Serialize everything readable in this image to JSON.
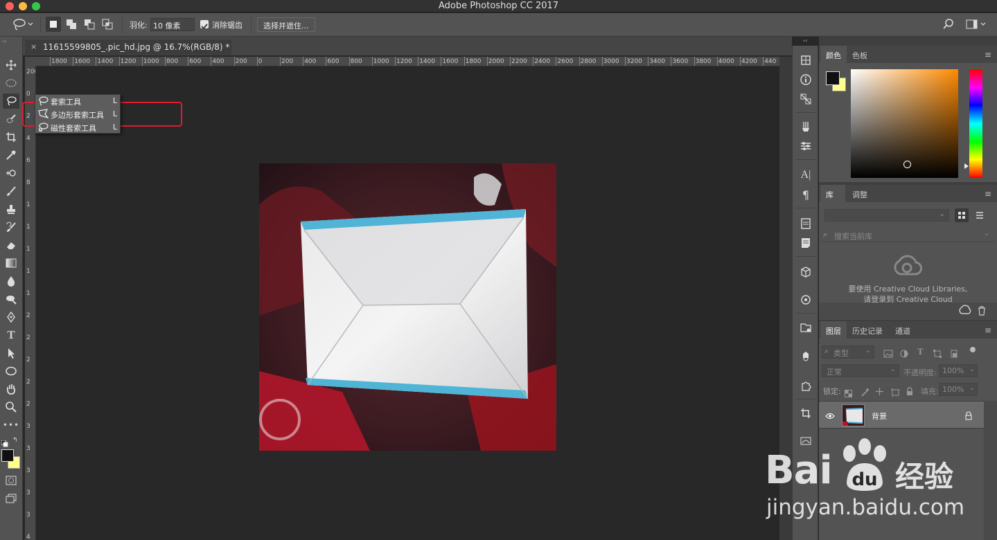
{
  "window": {
    "title": "Adobe Photoshop CC 2017"
  },
  "options_bar": {
    "feather_label": "羽化:",
    "feather_value": "10 像素",
    "antialias_label": "消除锯齿",
    "select_mask_button": "选择并遮住..."
  },
  "document": {
    "tab_title": "11615599805_.pic_hd.jpg @ 16.7%(RGB/8) *",
    "close_symbol": "×"
  },
  "ruler": {
    "h_labels": [
      "1800",
      "1600",
      "1400",
      "1200",
      "1000",
      "800",
      "600",
      "400",
      "200",
      "0",
      "200",
      "400",
      "600",
      "800",
      "1000",
      "1200",
      "1400",
      "1600",
      "1800",
      "2000",
      "2200",
      "2400",
      "2600",
      "2800",
      "3000",
      "3200",
      "3400",
      "3600",
      "3800",
      "4000",
      "4200",
      "440"
    ],
    "v_labels": [
      "200",
      "0",
      "2",
      "4",
      "6",
      "8",
      "1",
      "1",
      "1",
      "1",
      "1",
      "2",
      "2",
      "2",
      "2",
      "2",
      "3",
      "3",
      "3",
      "3",
      "3",
      "4"
    ]
  },
  "lasso_flyout": {
    "items": [
      {
        "label": "套索工具",
        "key": "L"
      },
      {
        "label": "多边形套索工具",
        "key": "L"
      },
      {
        "label": "磁性套索工具",
        "key": "L"
      }
    ]
  },
  "color_panel": {
    "tabs": [
      "颜色",
      "色板"
    ],
    "foreground": "#111111",
    "background": "#fffe8c"
  },
  "library_panel": {
    "tabs": [
      "库",
      "调整"
    ],
    "search_placeholder": "搜索当前库",
    "message_line1": "要使用 Creative Cloud Libraries,",
    "message_line2": "请登录到 Creative Cloud"
  },
  "layers_panel": {
    "tabs": [
      "图层",
      "历史记录",
      "通道"
    ],
    "filter_label": "类型",
    "blend_mode": "正常",
    "opacity_label": "不透明度:",
    "opacity_value": "100%",
    "lock_label": "锁定:",
    "fill_label": "填充:",
    "fill_value": "100%",
    "layers": [
      {
        "name": "背景",
        "visible": true,
        "locked": true
      }
    ]
  },
  "watermark": {
    "brand": "Bai",
    "brand_cn": "经验",
    "url": "jingyan.baidu.com"
  },
  "colors": {
    "accent_red": "#e01b2f",
    "panel": "#535353"
  }
}
